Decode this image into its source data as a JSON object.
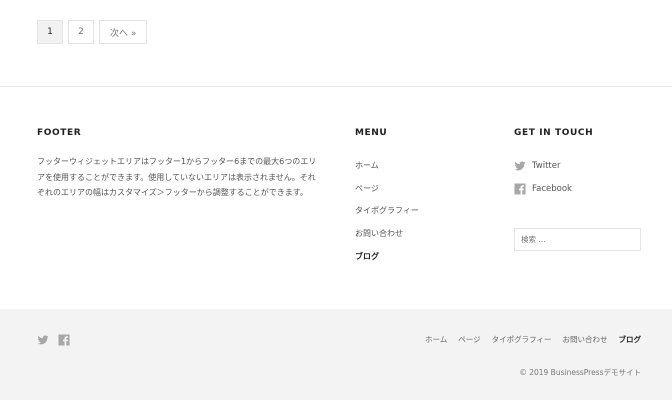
{
  "pagination": {
    "pages": [
      "1",
      "2"
    ],
    "current": "1",
    "next_label": "次へ »"
  },
  "footer": {
    "widget1": {
      "title": "FOOTER",
      "text": "フッターウィジェットエリアはフッター1からフッター6までの最大6つのエリアを使用することができます。使用していないエリアは表示されません。それぞれのエリアの幅はカスタマイズ＞フッターから調整することができます。"
    },
    "menu": {
      "title": "MENU",
      "items": [
        "ホーム",
        "ページ",
        "タイポグラフィー",
        "お問い合わせ",
        "ブログ"
      ],
      "active": "ブログ"
    },
    "contact": {
      "title": "GET IN TOUCH",
      "social": [
        {
          "icon": "twitter-icon",
          "label": "Twitter"
        },
        {
          "icon": "facebook-icon",
          "label": "Facebook"
        }
      ],
      "search_placeholder": "検索 …"
    }
  },
  "bottom_bar": {
    "nav": [
      "ホーム",
      "ページ",
      "タイポグラフィー",
      "お問い合わせ",
      "ブログ"
    ],
    "active": "ブログ",
    "copyright": "© 2019 BusinessPressデモサイト"
  },
  "colors": {
    "icon_gray": "#a7a7a7",
    "bottom_bg": "#f3f3f4",
    "border": "#e4e4e4"
  }
}
